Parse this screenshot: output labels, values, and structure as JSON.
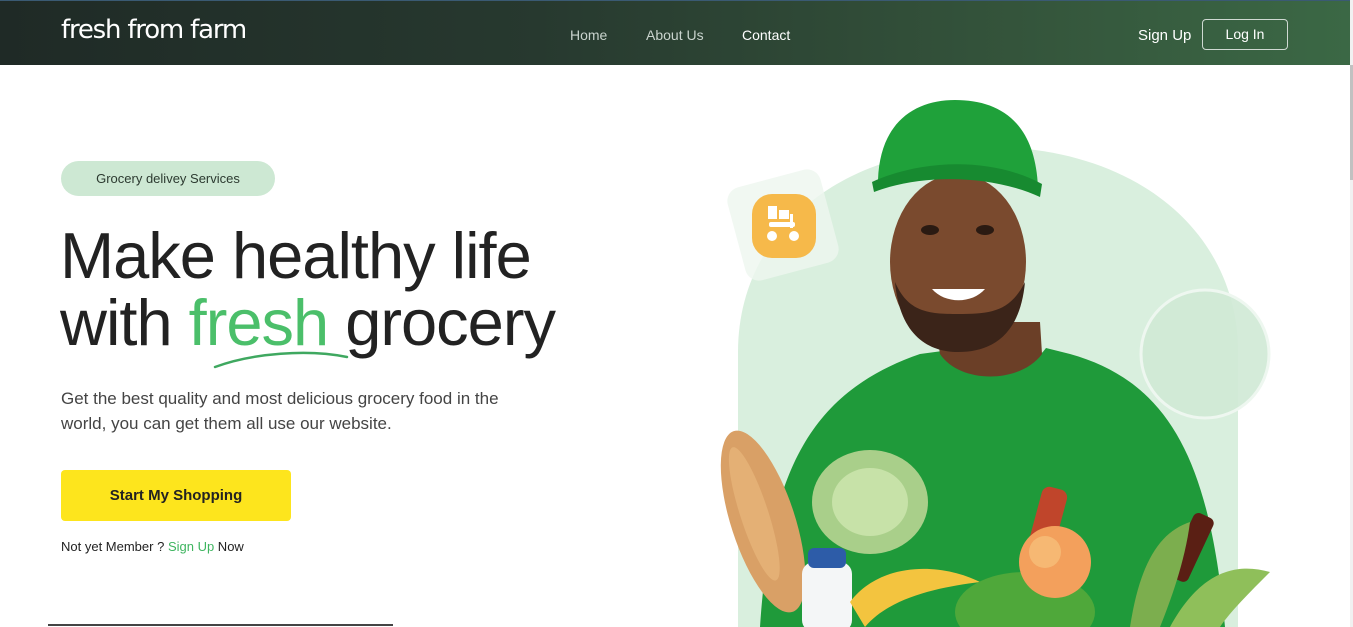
{
  "header": {
    "brand": "fresh from farm",
    "nav": [
      {
        "label": "Home",
        "active": false
      },
      {
        "label": "About Us",
        "active": false
      },
      {
        "label": "Contact",
        "active": true
      }
    ],
    "signup_label": "Sign Up",
    "login_label": "Log In"
  },
  "hero": {
    "badge": "Grocery delivey Services",
    "headline_line1": "Make healthy life",
    "headline_with": "with ",
    "headline_highlight": "fresh",
    "headline_end": " grocery",
    "description": "Get the best quality and most delicious grocery food in the world, you can get them all use our website.",
    "cta_label": "Start My Shopping",
    "member_prefix": "Not yet Member ? ",
    "member_link": "Sign Up",
    "member_suffix": " Now"
  },
  "colors": {
    "accent_green": "#4bbf6a",
    "cta_yellow": "#fde51d",
    "badge_bg": "#cde8d3",
    "shirt_green": "#1f9a3a"
  },
  "icons": {
    "delivery": "delivery-scooter-icon"
  }
}
